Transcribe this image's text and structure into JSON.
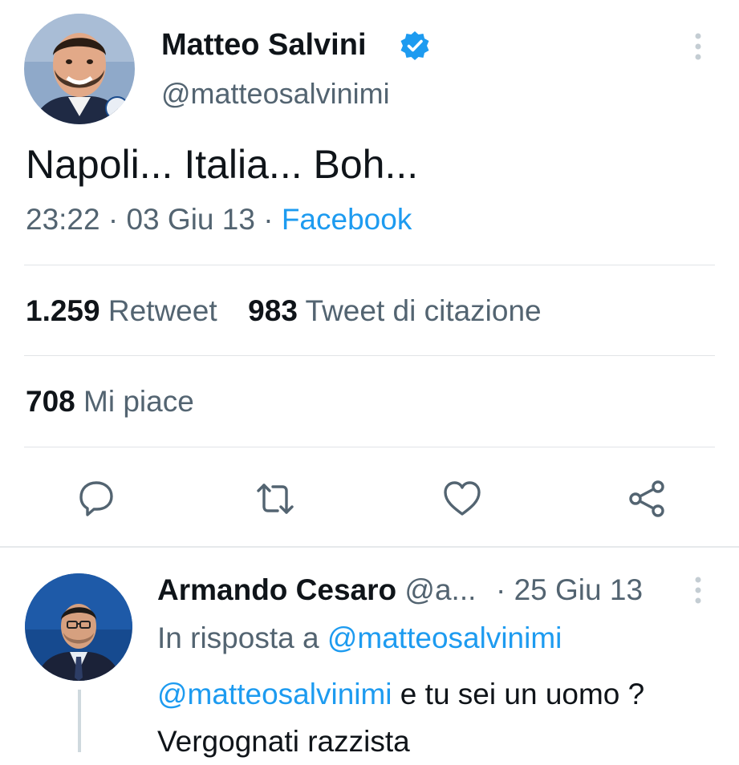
{
  "tweet": {
    "author_name": "Matteo Salvini",
    "author_handle": "@matteosalvinimi",
    "verified": true,
    "text": "Napoli... Italia... Boh...",
    "time": "23:22",
    "date": "03 Giu 13",
    "separator": "·",
    "source": "Facebook",
    "stats": {
      "retweets_count": "1.259",
      "retweets_label": "Retweet",
      "quotes_count": "983",
      "quotes_label": "Tweet di citazione",
      "likes_count": "708",
      "likes_label": "Mi piace"
    },
    "actions": [
      {
        "icon": "reply-icon"
      },
      {
        "icon": "retweet-icon"
      },
      {
        "icon": "like-icon"
      },
      {
        "icon": "share-icon"
      }
    ]
  },
  "reply": {
    "author_name": "Armando Cesaro",
    "author_handle_truncated": "@a...",
    "separator": "·",
    "date": "25 Giu 13",
    "in_reply_to_label": "In risposta a",
    "in_reply_to_handle": "@matteosalvinimi",
    "mention": "@matteosalvinimi",
    "text_after_mention": " e tu sei un uomo ?",
    "text_line2": "Vergognati razzista"
  },
  "colors": {
    "accent": "#1d9bf0",
    "secondary_text": "#536471",
    "primary_text": "#0f1419",
    "divider": "#e1e4e7"
  }
}
